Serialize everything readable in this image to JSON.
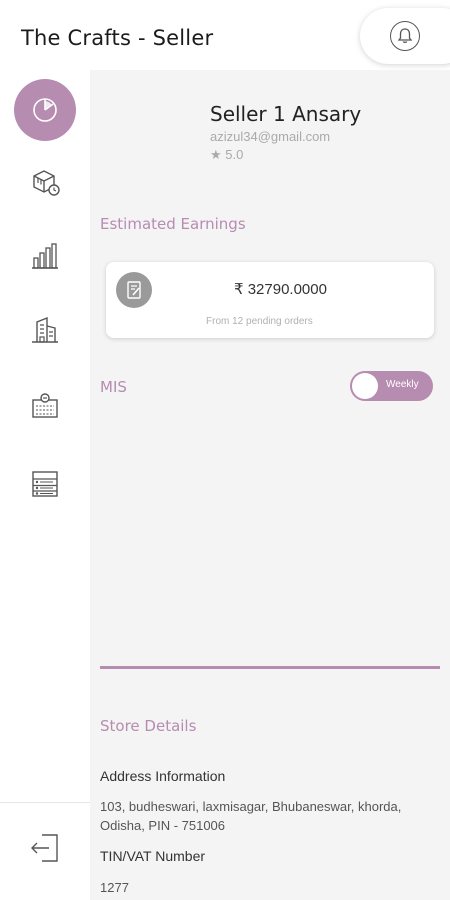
{
  "header": {
    "title": "The Crafts - Seller",
    "bell_icon": "bell-icon"
  },
  "sidebar": {
    "items": [
      {
        "icon": "pie-chart-icon",
        "active": true
      },
      {
        "icon": "box-clock-icon",
        "active": false
      },
      {
        "icon": "bar-chart-icon",
        "active": false
      },
      {
        "icon": "building-icon",
        "active": false
      },
      {
        "icon": "store-icon",
        "active": false
      },
      {
        "icon": "list-table-icon",
        "active": false
      }
    ],
    "logout_icon": "logout-icon"
  },
  "profile": {
    "name": "Seller 1 Ansary",
    "email": "azizul34@gmail.com",
    "rating": "★ 5.0"
  },
  "earnings": {
    "title": "Estimated Earnings",
    "amount": "₹ 32790.0000",
    "subtitle": "From 12 pending orders"
  },
  "mis": {
    "label": "MIS",
    "toggle_label": "Weekly"
  },
  "store": {
    "title": "Store Details",
    "address_label": "Address Information",
    "address_value": "103, budheswari, laxmisagar, Bhubaneswar, khorda, Odisha, PIN - 751006",
    "tin_label": "TIN/VAT Number",
    "tin_value": "1277"
  },
  "colors": {
    "accent": "#b78cb1",
    "background": "#f4f4f4"
  }
}
